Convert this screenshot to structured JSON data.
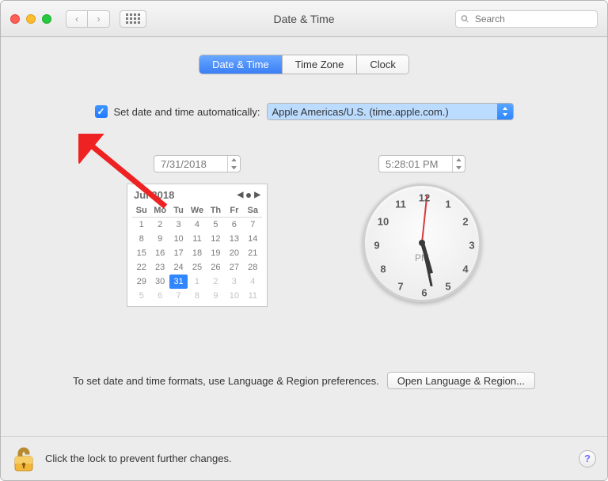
{
  "window": {
    "title": "Date & Time"
  },
  "toolbar": {
    "search_placeholder": "Search"
  },
  "tabs": {
    "date_time": "Date & Time",
    "time_zone": "Time Zone",
    "clock": "Clock",
    "active": "date_time"
  },
  "auto": {
    "checked": true,
    "label": "Set date and time automatically:",
    "server": "Apple Americas/U.S. (time.apple.com.)"
  },
  "date_field": "7/31/2018",
  "time_field": "5:28:01 PM",
  "calendar": {
    "month_label": "Jul 2018",
    "day_headers": [
      "Su",
      "Mo",
      "Tu",
      "We",
      "Th",
      "Fr",
      "Sa"
    ],
    "weeks": [
      [
        {
          "n": 1
        },
        {
          "n": 2
        },
        {
          "n": 3
        },
        {
          "n": 4
        },
        {
          "n": 5
        },
        {
          "n": 6
        },
        {
          "n": 7
        }
      ],
      [
        {
          "n": 8
        },
        {
          "n": 9
        },
        {
          "n": 10
        },
        {
          "n": 11
        },
        {
          "n": 12
        },
        {
          "n": 13
        },
        {
          "n": 14
        }
      ],
      [
        {
          "n": 15
        },
        {
          "n": 16
        },
        {
          "n": 17
        },
        {
          "n": 18
        },
        {
          "n": 19
        },
        {
          "n": 20
        },
        {
          "n": 21
        }
      ],
      [
        {
          "n": 22
        },
        {
          "n": 23
        },
        {
          "n": 24
        },
        {
          "n": 25
        },
        {
          "n": 26
        },
        {
          "n": 27
        },
        {
          "n": 28
        }
      ],
      [
        {
          "n": 29
        },
        {
          "n": 30
        },
        {
          "n": 31,
          "selected": true
        },
        {
          "n": 1,
          "other": true
        },
        {
          "n": 2,
          "other": true
        },
        {
          "n": 3,
          "other": true
        },
        {
          "n": 4,
          "other": true
        }
      ],
      [
        {
          "n": 5,
          "other": true
        },
        {
          "n": 6,
          "other": true
        },
        {
          "n": 7,
          "other": true
        },
        {
          "n": 8,
          "other": true
        },
        {
          "n": 9,
          "other": true
        },
        {
          "n": 10,
          "other": true
        },
        {
          "n": 11,
          "other": true
        }
      ]
    ]
  },
  "clock": {
    "numbers": [
      "12",
      "1",
      "2",
      "3",
      "4",
      "5",
      "6",
      "7",
      "8",
      "9",
      "10",
      "11"
    ],
    "ampm": "PM",
    "hour": 5,
    "minute": 28,
    "second": 1
  },
  "formats": {
    "text": "To set date and time formats, use Language & Region preferences.",
    "button": "Open Language & Region..."
  },
  "footer": {
    "lock_text": "Click the lock to prevent further changes.",
    "help": "?"
  }
}
